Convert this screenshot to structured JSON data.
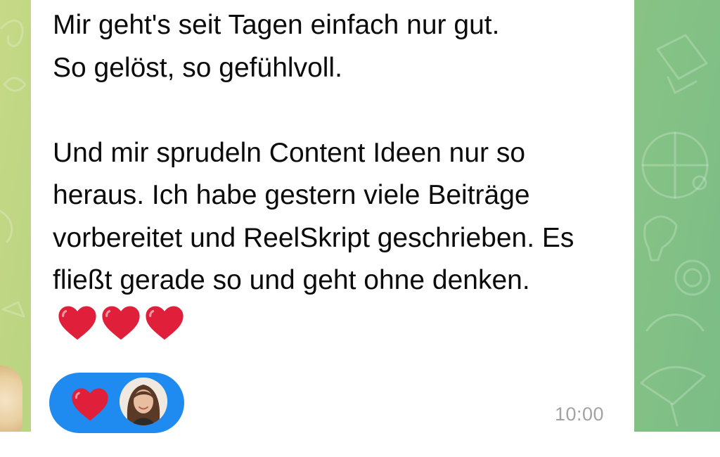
{
  "message": {
    "text": "Mir geht's seit Tagen einfach nur gut.\nSo gelöst,  so gefühlvoll.\n\nUnd mir sprudeln Content Ideen nur so heraus. Ich habe gestern viele Beiträge vorbereitet und ReelSkript geschrieben. Es fließt gerade so und geht ohne denken.",
    "trailing_emojis": [
      "heart-icon",
      "heart-icon",
      "heart-icon"
    ],
    "timestamp": "10:00"
  },
  "reaction": {
    "emoji": "heart-icon",
    "reactor": "avatar"
  },
  "colors": {
    "bubble": "#ffffff",
    "reaction_pill": "#1f8af0",
    "heart": "#e0203a",
    "timestamp": "#a3a3a3",
    "chat_background": "#9fca7f"
  }
}
